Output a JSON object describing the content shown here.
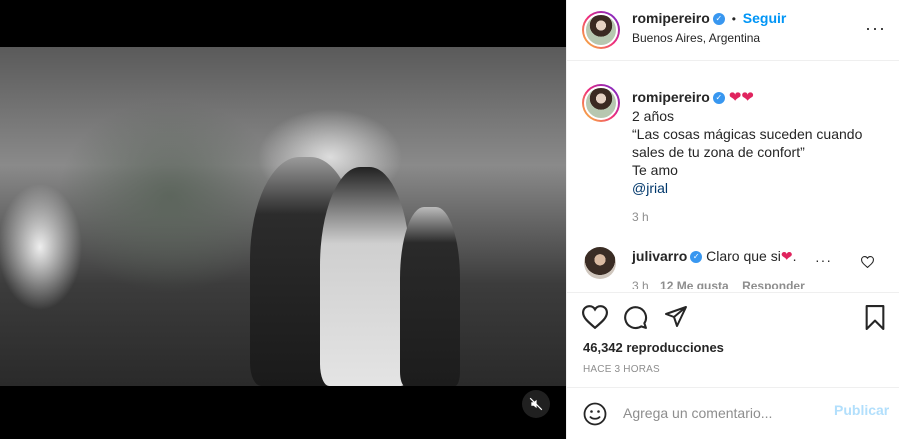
{
  "post": {
    "author": "romipereiro",
    "follow_label": "Seguir",
    "separator": "•",
    "location": "Buenos Aires, Argentina",
    "caption_lines": [
      "2 años",
      "“Las cosas mágicas suceden cuando",
      "sales de tu zona de confort”",
      "Te amo"
    ],
    "caption_hearts": "❤❤",
    "mention": "@jrial",
    "time": "3 h"
  },
  "comment": {
    "user": "julivarro",
    "text": "Claro que si",
    "heart": "❤",
    "trail": ".",
    "time": "3 h",
    "likes": "12 Me gusta",
    "reply": "Responder"
  },
  "stats": {
    "views": "46,342 reproducciones",
    "posted": "HACE 3 HORAS"
  },
  "add_comment": {
    "placeholder": "Agrega un comentario...",
    "publish_label": "Publicar"
  },
  "colors": {
    "accent": "#0095f6",
    "heart": "#e0245e",
    "verified": "#3897f0",
    "publish_disabled": "#b2dffc"
  },
  "icons": [
    "volume-off-icon",
    "verified-badge-icon",
    "more-options-icon",
    "heart-icon",
    "comment-icon",
    "share-icon",
    "bookmark-icon",
    "emoji-icon"
  ]
}
